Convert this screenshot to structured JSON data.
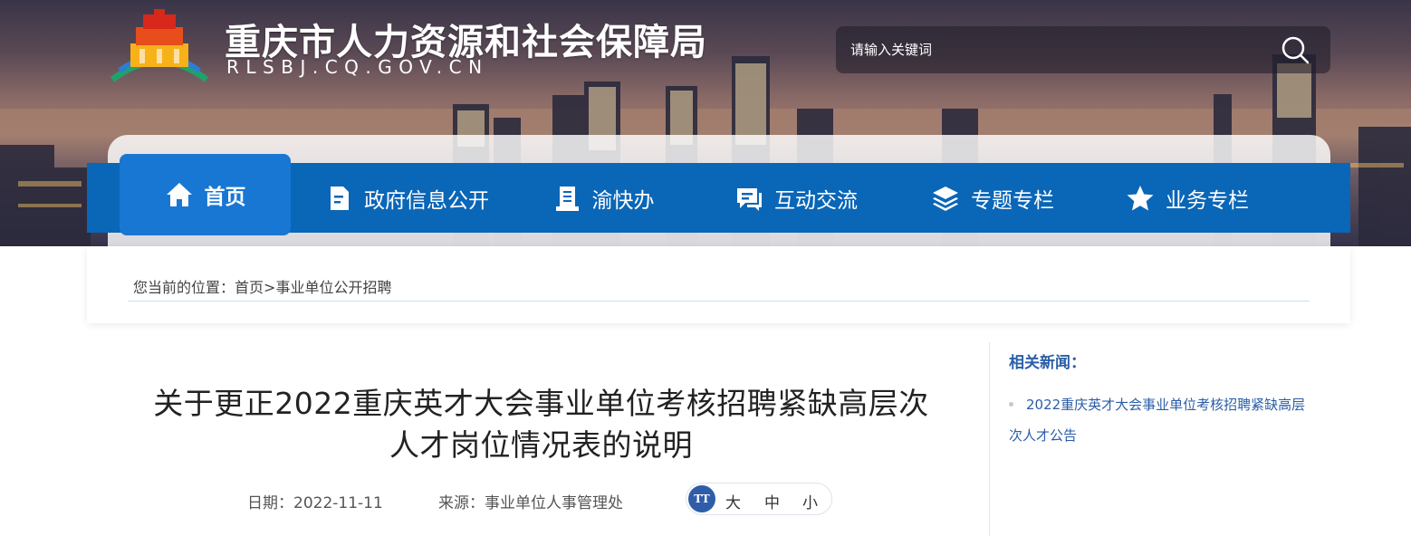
{
  "header": {
    "site_title": "重庆市人力资源和社会保障局",
    "site_domain": "RLSBJ.CQ.GOV.CN",
    "search_placeholder": "请输入关键词"
  },
  "nav": {
    "items": [
      {
        "label": "首页",
        "icon": "home-icon"
      },
      {
        "label": "政府信息公开",
        "icon": "document-icon"
      },
      {
        "label": "渝快办",
        "icon": "handbook-icon"
      },
      {
        "label": "互动交流",
        "icon": "chat-icon"
      },
      {
        "label": "专题专栏",
        "icon": "layers-icon"
      },
      {
        "label": "业务专栏",
        "icon": "star-icon"
      }
    ]
  },
  "breadcrumb": {
    "prefix": "您当前的位置：",
    "home": "首页",
    "separator": ">",
    "current": "事业单位公开招聘"
  },
  "article": {
    "title_line1": "关于更正2022重庆英才大会事业单位考核招聘紧缺高层次",
    "title_line2": "人才岗位情况表的说明",
    "date_label": "日期：",
    "date": "2022-11-11",
    "source_label": "来源：",
    "source": "事业单位人事管理处",
    "font_size": {
      "icon_text": "TT",
      "large": "大",
      "medium": "中",
      "small": "小"
    }
  },
  "sidebar": {
    "title": "相关新闻：",
    "news": [
      {
        "line1": "2022重庆英才大会事业单位考核招聘紧缺高层",
        "line2": "次人才公告"
      }
    ]
  },
  "colors": {
    "nav_blue": "#0a66b7",
    "nav_active": "#1877d3",
    "link_blue": "#2a5ea8"
  }
}
